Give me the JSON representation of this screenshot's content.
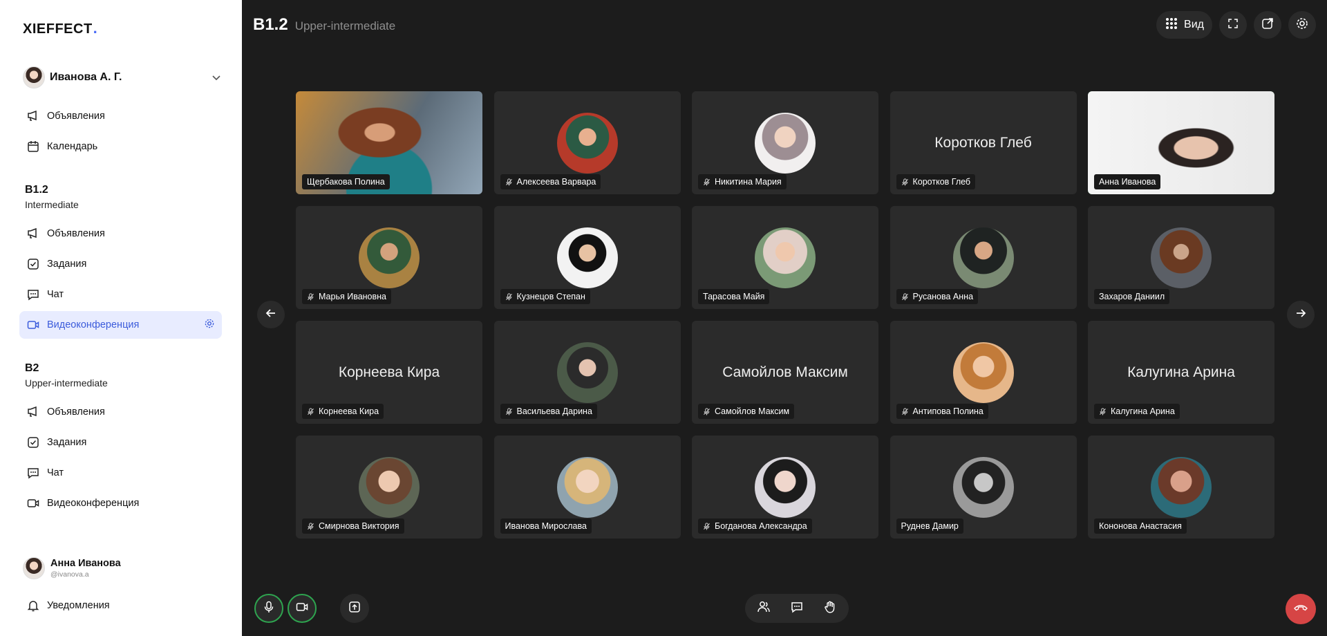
{
  "app": {
    "logo_text": "XIEFFECT",
    "logo_dot": "."
  },
  "sidebar": {
    "user_name": "Иванова А. Г.",
    "top_items": [
      {
        "label": "Объявления",
        "icon": "megaphone-icon"
      },
      {
        "label": "Календарь",
        "icon": "calendar-icon"
      }
    ],
    "groups": [
      {
        "title": "B1.2",
        "subtitle": "Intermediate",
        "items": [
          {
            "label": "Объявления",
            "icon": "megaphone-icon"
          },
          {
            "label": "Задания",
            "icon": "task-check-icon"
          },
          {
            "label": "Чат",
            "icon": "chat-icon"
          },
          {
            "label": "Видеоконференция",
            "icon": "video-camera-icon",
            "active": true
          }
        ]
      },
      {
        "title": "B2",
        "subtitle": "Upper-intermediate",
        "items": [
          {
            "label": "Объявления",
            "icon": "megaphone-icon"
          },
          {
            "label": "Задания",
            "icon": "task-check-icon"
          },
          {
            "label": "Чат",
            "icon": "chat-icon"
          },
          {
            "label": "Видеоконференция",
            "icon": "video-camera-icon"
          }
        ]
      }
    ],
    "profile": {
      "name": "Анна Иванова",
      "handle": "@ivanova.a"
    },
    "notifications_label": "Уведомления",
    "accent_color": "#3b5bdb"
  },
  "header": {
    "code": "B1.2",
    "level": "Upper-intermediate",
    "view_label": "Вид"
  },
  "participants": [
    {
      "name": "Щербакова Полина",
      "kind": "photo",
      "muted": false
    },
    {
      "name": "Алексеева Варвара",
      "kind": "avatar",
      "muted": true
    },
    {
      "name": "Никитина Мария",
      "kind": "avatar",
      "muted": true
    },
    {
      "name": "Коротков Глеб",
      "kind": "text",
      "muted": true
    },
    {
      "name": "Анна Иванова",
      "kind": "photo",
      "muted": false,
      "speaking": true
    },
    {
      "name": "Марья Ивановна",
      "kind": "avatar",
      "muted": true
    },
    {
      "name": "Кузнецов Степан",
      "kind": "avatar",
      "muted": true
    },
    {
      "name": "Тарасова Майя",
      "kind": "avatar",
      "muted": false
    },
    {
      "name": "Русанова Анна",
      "kind": "avatar",
      "muted": true
    },
    {
      "name": "Захаров Даниил",
      "kind": "avatar",
      "muted": false
    },
    {
      "name": "Корнеева Кира",
      "kind": "text",
      "muted": true
    },
    {
      "name": "Васильева Дарина",
      "kind": "avatar",
      "muted": true
    },
    {
      "name": "Самойлов Максим",
      "kind": "text",
      "muted": true
    },
    {
      "name": "Антипова Полина",
      "kind": "avatar",
      "muted": true
    },
    {
      "name": "Калугина Арина",
      "kind": "text",
      "muted": true
    },
    {
      "name": "Смирнова Виктория",
      "kind": "avatar",
      "muted": true
    },
    {
      "name": "Иванова Мирослава",
      "kind": "avatar",
      "muted": false
    },
    {
      "name": "Богданова Александра",
      "kind": "avatar",
      "muted": true
    },
    {
      "name": "Руднев Дамир",
      "kind": "avatar",
      "muted": false
    },
    {
      "name": "Кононова Анастасия",
      "kind": "avatar",
      "muted": false
    }
  ],
  "colors": {
    "speaking_border": "#2ea44f",
    "hangup": "#d64545"
  }
}
